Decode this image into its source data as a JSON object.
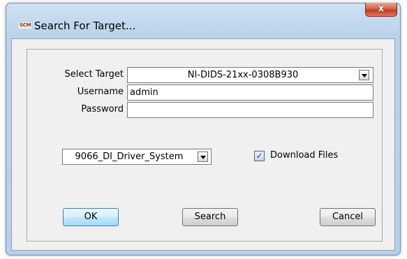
{
  "window": {
    "title": "Search For Target...",
    "app_icon_text": "SCM",
    "close_glyph": "x"
  },
  "form": {
    "select_target_label": "Select Target",
    "select_target_value": "NI-DIDS-21xx-0308B930",
    "username_label": "Username",
    "username_value": "admin",
    "password_label": "Password",
    "password_value": "",
    "system_value": "9066_DI_Driver_System",
    "download_files_label": "Download Files",
    "download_files_checked": true,
    "check_glyph": "✓"
  },
  "buttons": {
    "ok_label": "OK",
    "search_label": "Search",
    "cancel_label": "Cancel"
  },
  "icons": {
    "close": "close-icon",
    "dropdown": "chevron-down-icon",
    "app": "scm-app-icon"
  },
  "colors": {
    "title_bar": "#b9d1ea",
    "close_button": "#c94a33",
    "default_button_border": "#3c7fb1",
    "dialog_background": "#f0f0f0"
  }
}
